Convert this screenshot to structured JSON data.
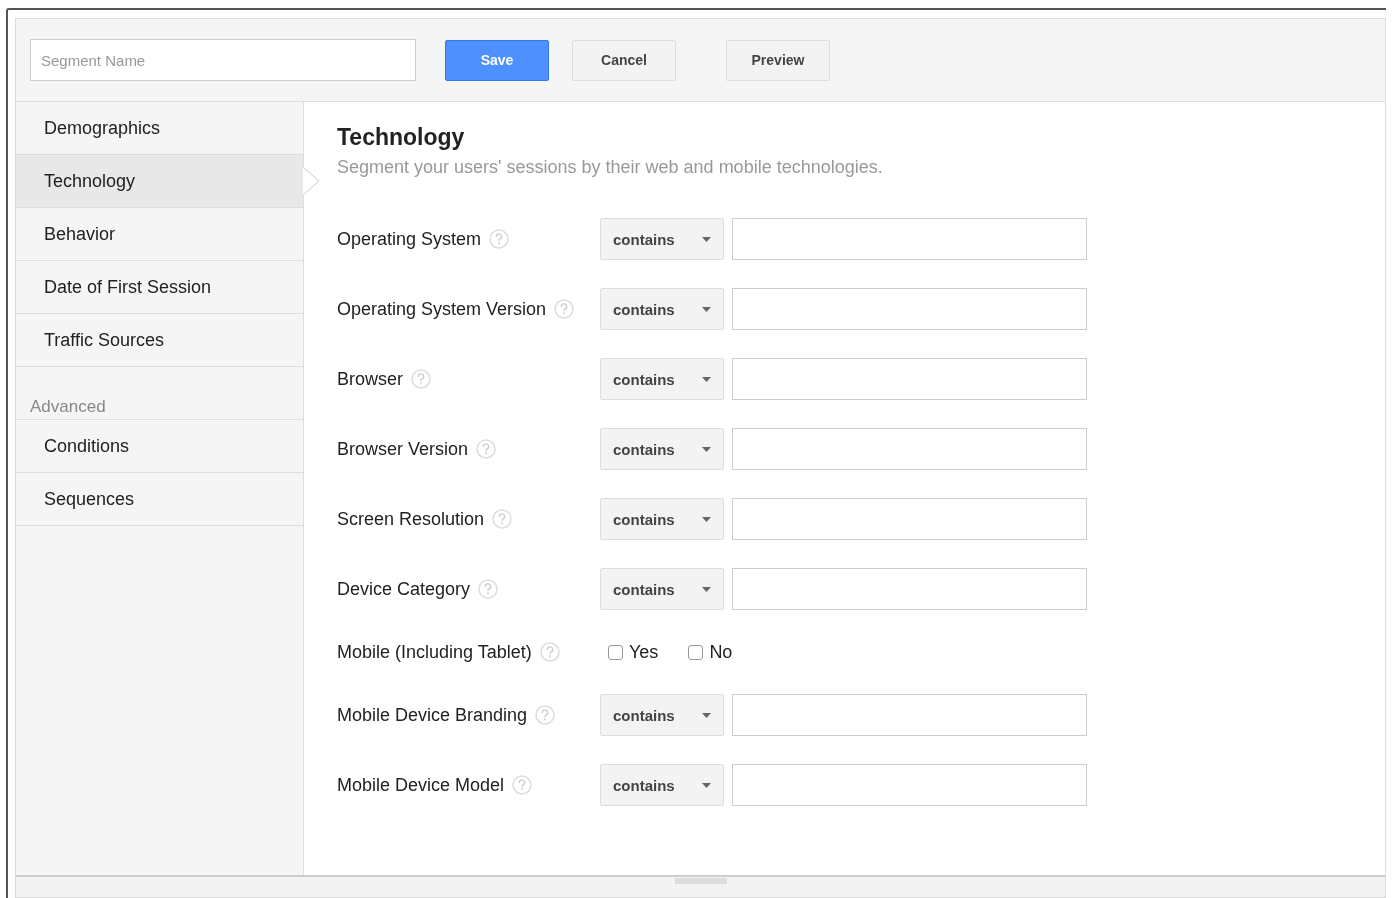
{
  "toolbar": {
    "segment_name": {
      "placeholder": "Segment Name"
    },
    "buttons": [
      {
        "label": "Save",
        "kind": "primary"
      },
      {
        "label": "Cancel",
        "kind": "default"
      },
      {
        "label": "Preview",
        "kind": "default"
      }
    ]
  },
  "sidebar": {
    "items": [
      {
        "label": "Demographics",
        "selected": false
      },
      {
        "label": "Technology",
        "selected": true
      },
      {
        "label": "Behavior",
        "selected": false
      },
      {
        "label": "Date of First Session",
        "selected": false
      },
      {
        "label": "Traffic Sources",
        "selected": false
      }
    ],
    "advanced_heading": "Advanced",
    "advanced_items": [
      {
        "label": "Conditions",
        "selected": false
      },
      {
        "label": "Sequences",
        "selected": false
      }
    ]
  },
  "panel": {
    "title": "Technology",
    "subtitle": "Segment your users' sessions by their web and mobile technologies.",
    "rows": [
      {
        "kind": "select",
        "label": "Operating System",
        "operator": "contains"
      },
      {
        "kind": "select",
        "label": "Operating System Version",
        "operator": "contains"
      },
      {
        "kind": "select",
        "label": "Browser",
        "operator": "contains"
      },
      {
        "kind": "select",
        "label": "Browser Version",
        "operator": "contains"
      },
      {
        "kind": "select",
        "label": "Screen Resolution",
        "operator": "contains"
      },
      {
        "kind": "select",
        "label": "Device Category",
        "operator": "contains"
      },
      {
        "kind": "checkboxes",
        "label": "Mobile (Including Tablet)",
        "options": [
          {
            "label": "Yes",
            "checked": false
          },
          {
            "label": "No",
            "checked": false
          }
        ]
      },
      {
        "kind": "select",
        "label": "Mobile Device Branding",
        "operator": "contains"
      },
      {
        "kind": "select",
        "label": "Mobile Device Model",
        "operator": "contains"
      }
    ]
  }
}
